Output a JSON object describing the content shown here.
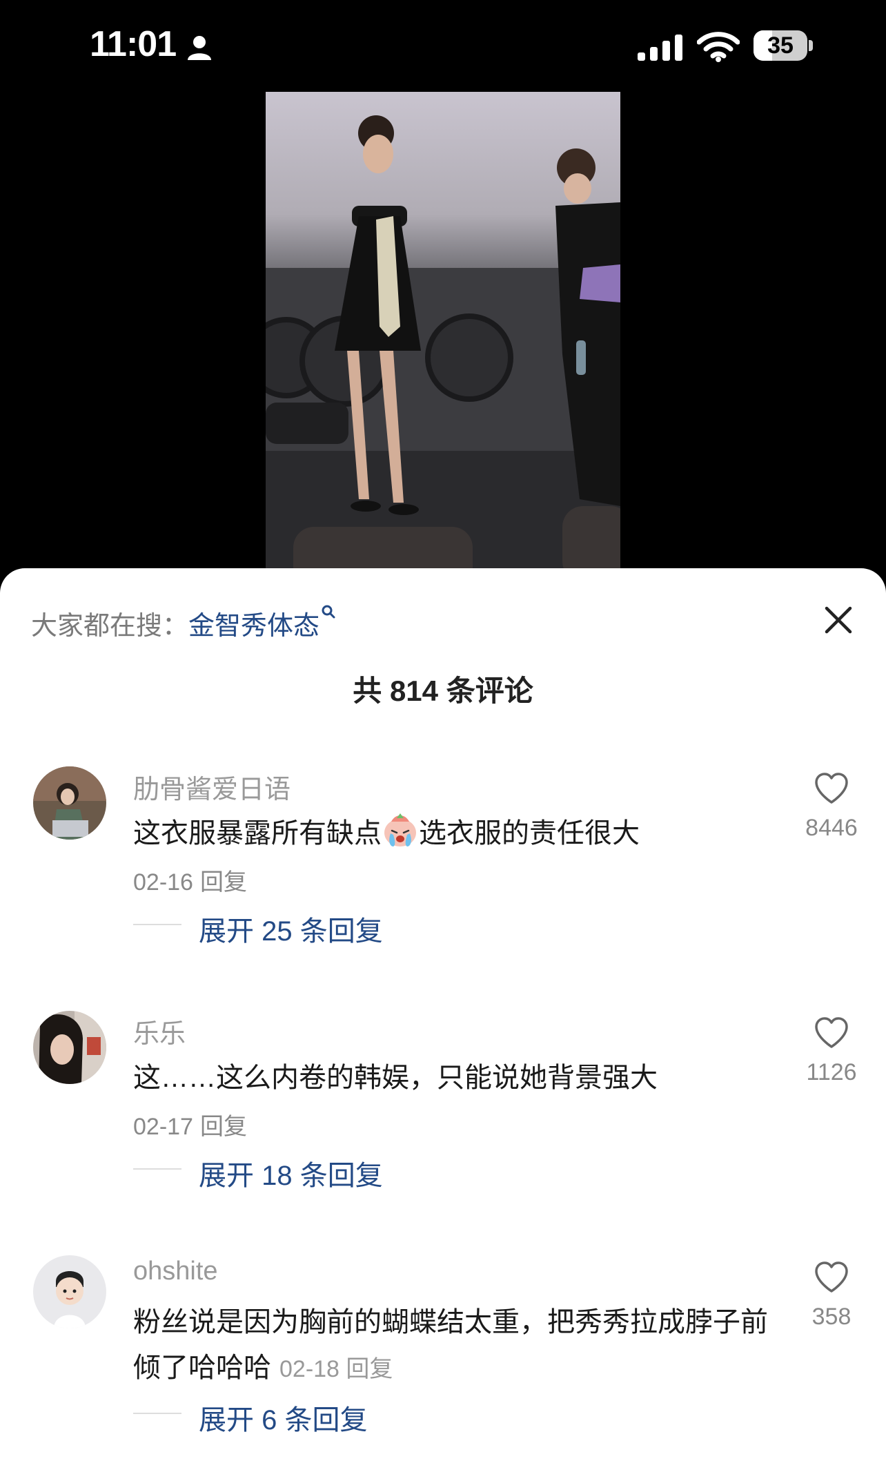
{
  "status_bar": {
    "time": "11:01",
    "battery": "35",
    "battery_level": 0.35
  },
  "search_hint": {
    "label": "大家都在搜：",
    "term": "金智秀体态"
  },
  "comment_count": "共 814 条评论",
  "comments": [
    {
      "username": "肋骨酱爱日语",
      "text_before": "这衣服暴露所有缺点",
      "emoji": "crying-face-emoji",
      "text_after": "选衣服的责任很大",
      "date": "02-16",
      "reply_label": "回复",
      "likes": "8446",
      "expand_label": "展开 25 条回复"
    },
    {
      "username": "乐乐",
      "text": "这……这么内卷的韩娱，只能说她背景强大",
      "date": "02-17",
      "reply_label": "回复",
      "likes": "1126",
      "expand_label": "展开 18 条回复"
    },
    {
      "username": "ohshite",
      "text": "粉丝说是因为胸前的蝴蝶结太重，把秀秀拉成脖子前倾了哈哈哈",
      "date": "02-18",
      "reply_label": "回复",
      "likes": "358",
      "expand_label": "展开 6 条回复"
    }
  ]
}
